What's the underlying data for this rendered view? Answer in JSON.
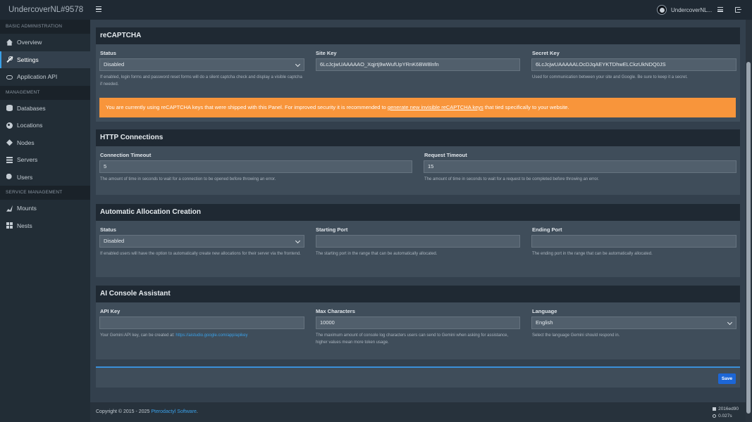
{
  "app": {
    "brand": "UndercoverNL#9578",
    "user_name": "UndercoverNL..."
  },
  "sidebar": {
    "sections": [
      {
        "header": "BASIC ADMINISTRATION",
        "items": [
          {
            "label": "Overview",
            "icon": "home-icon"
          },
          {
            "label": "Settings",
            "icon": "wrench-icon",
            "active": true
          },
          {
            "label": "Application API",
            "icon": "link-icon"
          }
        ]
      },
      {
        "header": "MANAGEMENT",
        "items": [
          {
            "label": "Databases",
            "icon": "database-icon"
          },
          {
            "label": "Locations",
            "icon": "globe-icon"
          },
          {
            "label": "Nodes",
            "icon": "sitemap-icon"
          },
          {
            "label": "Servers",
            "icon": "server-icon"
          },
          {
            "label": "Users",
            "icon": "users-icon"
          }
        ]
      },
      {
        "header": "SERVICE MANAGEMENT",
        "items": [
          {
            "label": "Mounts",
            "icon": "magic-icon"
          },
          {
            "label": "Nests",
            "icon": "th-large-icon"
          }
        ]
      }
    ]
  },
  "recaptcha": {
    "title": "reCAPTCHA",
    "status_label": "Status",
    "status_value": "Disabled",
    "status_help": "If enabled, login forms and password reset forms will do a silent captcha check and display a visible captcha if needed.",
    "site_key_label": "Site Key",
    "site_key_value": "6LcJcjwUAAAAAO_Xqjrtj9wWufUpYRnK6BW8lnfn",
    "secret_key_label": "Secret Key",
    "secret_key_value": "6LcJcjwUAAAAALOcDJqAEYKTDhwELCkzUkNDQ0JS",
    "secret_key_help": "Used for communication between your site and Google. Be sure to keep it a secret.",
    "alert_text_before": "You are currently using reCAPTCHA keys that were shipped with this Panel. For improved security it is recommended to ",
    "alert_link": "generate new invisible reCAPTCHA keys",
    "alert_text_after": " that tied specifically to your website."
  },
  "http": {
    "title": "HTTP Connections",
    "connection_label": "Connection Timeout",
    "connection_value": "5",
    "connection_help": "The amount of time in seconds to wait for a connection to be opened before throwing an error.",
    "request_label": "Request Timeout",
    "request_value": "15",
    "request_help": "The amount of time in seconds to wait for a request to be completed before throwing an error."
  },
  "allocation": {
    "title": "Automatic Allocation Creation",
    "status_label": "Status",
    "status_value": "Disabled",
    "status_help": "If enabled users will have the option to automatically create new allocations for their server via the frontend.",
    "start_label": "Starting Port",
    "start_value": "",
    "start_help": "The starting port in the range that can be automatically allocated.",
    "end_label": "Ending Port",
    "end_value": "",
    "end_help": "The ending port in the range that can be automatically allocated."
  },
  "ai": {
    "title": "AI Console Assistant",
    "api_key_label": "API Key",
    "api_key_value": "",
    "api_key_help": "Your Gemini API key, can be created at: ",
    "api_key_link": "https://aistudio.google.com/app/apikey",
    "max_chars_label": "Max Characters",
    "max_chars_value": "10000",
    "max_chars_help": "The maximum amount of console log characters users can send to Gemini when asking for assistance, higher values mean more token usage.",
    "language_label": "Language",
    "language_value": "English",
    "language_help": "Select the language Gemini should respond in."
  },
  "actions": {
    "save_label": "Save"
  },
  "footer": {
    "copyright_prefix": "Copyright © 2015 - 2025 ",
    "copyright_link": "Pterodactyl Software",
    "copyright_suffix": ".",
    "version": "2016ed90",
    "render_time": "0.027s"
  },
  "colors": {
    "accent": "#3aa0e8",
    "alert": "#f8953b",
    "save_button": "#1c66d6",
    "sidebar_bg": "#222d36",
    "content_bg": "#33404d"
  }
}
